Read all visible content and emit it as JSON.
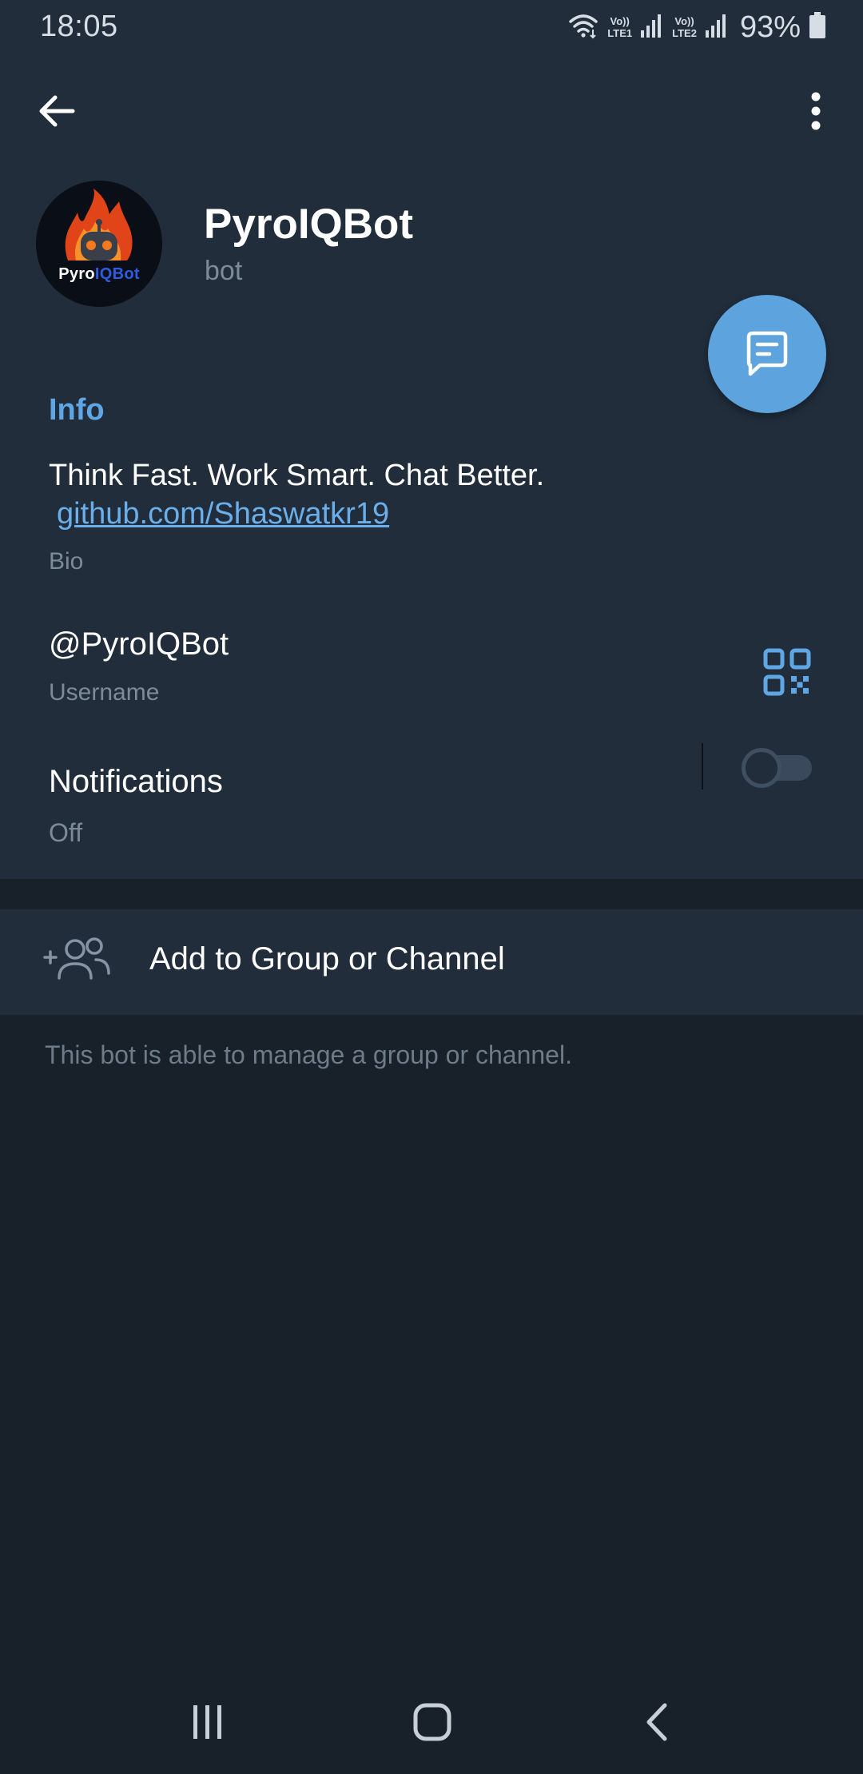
{
  "status_bar": {
    "time": "18:05",
    "sim1_label_top": "Vo))",
    "sim1_label_bottom": "LTE1",
    "sim2_label_top": "Vo))",
    "sim2_label_bottom": "LTE2",
    "battery": "93%",
    "icons": [
      "wifi-icon",
      "signal-icon",
      "signal-icon",
      "battery-icon"
    ]
  },
  "header": {
    "back_icon": "arrow-left-icon",
    "menu_icon": "more-vertical-icon"
  },
  "profile": {
    "avatar_text_a": "Pyro",
    "avatar_text_b": "IQBot",
    "name": "PyroIQBot",
    "status": "bot"
  },
  "fab": {
    "icon": "message-icon"
  },
  "info": {
    "title": "Info",
    "bio_text": "Think Fast. Work Smart. Chat Better.",
    "bio_link": "github.com/Shaswatkr19",
    "bio_label": "Bio",
    "username": "@PyroIQBot",
    "username_label": "Username",
    "qr_icon": "qr-code-icon",
    "notifications_title": "Notifications",
    "notifications_value": "Off",
    "notifications_enabled": false
  },
  "add_group": {
    "label": "Add to Group or Channel",
    "icon": "add-users-icon",
    "note": "This bot is able to manage a group or channel."
  },
  "nav": {
    "recents_icon": "recents-icon",
    "home_icon": "home-icon",
    "back_icon": "back-chevron-icon"
  },
  "colors": {
    "background": "#18202a",
    "surface": "#212d3b",
    "accent": "#5fa6e4",
    "fab": "#5da3de",
    "secondary_text": "#7d8b99"
  }
}
